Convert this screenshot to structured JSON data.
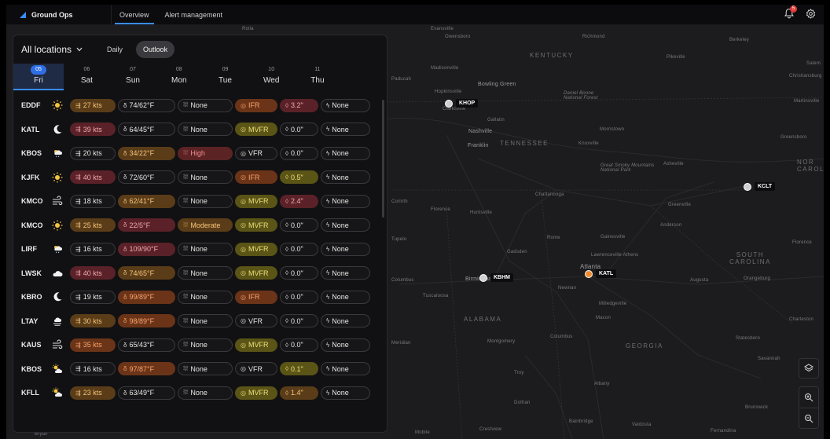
{
  "app": {
    "name": "Ground Ops"
  },
  "nav": {
    "tabs": [
      "Overview",
      "Alert management"
    ],
    "active": 0
  },
  "notifications": {
    "count": "5"
  },
  "panel": {
    "location_select": "All locations",
    "toggles": [
      "Daily",
      "Outlook"
    ],
    "active_toggle": "Outlook",
    "days": [
      {
        "num": "05",
        "name": "Fri"
      },
      {
        "num": "06",
        "name": "Sat"
      },
      {
        "num": "07",
        "name": "Sun"
      },
      {
        "num": "08",
        "name": "Mon"
      },
      {
        "num": "09",
        "name": "Tue"
      },
      {
        "num": "10",
        "name": "Wed"
      },
      {
        "num": "11",
        "name": "Thu"
      }
    ],
    "rows": [
      {
        "icao": "EDDF",
        "weather_icon": "sun-icon",
        "wind": "27 kts",
        "wind_level": "amber",
        "temp": "74/62°F",
        "temp_level": "",
        "precip": "None",
        "precip_level": "",
        "vis": "IFR",
        "vis_level": "orange",
        "rain": "3.2\"",
        "rain_level": "red",
        "storm": "None"
      },
      {
        "icao": "KATL",
        "weather_icon": "moon-icon",
        "wind": "39 kts",
        "wind_level": "red",
        "temp": "64/45°F",
        "temp_level": "",
        "precip": "None",
        "precip_level": "",
        "vis": "MVFR",
        "vis_level": "olive",
        "rain": "0.0\"",
        "rain_level": "",
        "storm": "None"
      },
      {
        "icao": "KBOS",
        "weather_icon": "rain-sun-icon",
        "wind": "20 kts",
        "wind_level": "",
        "temp": "34/22°F",
        "temp_level": "amber",
        "precip": "High",
        "precip_level": "redbg",
        "vis": "VFR",
        "vis_level": "",
        "rain": "0.0\"",
        "rain_level": "",
        "storm": "None"
      },
      {
        "icao": "KJFK",
        "weather_icon": "sun-icon",
        "wind": "40 kts",
        "wind_level": "red",
        "temp": "72/60°F",
        "temp_level": "",
        "precip": "None",
        "precip_level": "",
        "vis": "IFR",
        "vis_level": "orange",
        "rain": "0.5\"",
        "rain_level": "olive",
        "storm": "None"
      },
      {
        "icao": "KMCO",
        "weather_icon": "wind-icon",
        "wind": "18 kts",
        "wind_level": "",
        "temp": "62/41°F",
        "temp_level": "amber",
        "precip": "None",
        "precip_level": "",
        "vis": "MVFR",
        "vis_level": "olive",
        "rain": "2.4\"",
        "rain_level": "red",
        "storm": "None"
      },
      {
        "icao": "KMCO",
        "weather_icon": "sun-icon",
        "wind": "25 kts",
        "wind_level": "amber",
        "temp": "22/5°F",
        "temp_level": "red",
        "precip": "Moderate",
        "precip_level": "amber",
        "vis": "MVFR",
        "vis_level": "olive",
        "rain": "0.0\"",
        "rain_level": "",
        "storm": "None"
      },
      {
        "icao": "LIRF",
        "weather_icon": "rain-sun-icon",
        "wind": "16 kts",
        "wind_level": "",
        "temp": "109/90°F",
        "temp_level": "red",
        "precip": "None",
        "precip_level": "",
        "vis": "MVFR",
        "vis_level": "olive",
        "rain": "0.0\"",
        "rain_level": "",
        "storm": "None"
      },
      {
        "icao": "LWSK",
        "weather_icon": "cloud-icon",
        "wind": "40 kts",
        "wind_level": "red",
        "temp": "74/65°F",
        "temp_level": "amber",
        "precip": "None",
        "precip_level": "",
        "vis": "MVFR",
        "vis_level": "olive",
        "rain": "0.0\"",
        "rain_level": "",
        "storm": "None"
      },
      {
        "icao": "KBRO",
        "weather_icon": "moon-icon",
        "wind": "19 kts",
        "wind_level": "",
        "temp": "99/89°F",
        "temp_level": "orange",
        "precip": "None",
        "precip_level": "",
        "vis": "IFR",
        "vis_level": "orange",
        "rain": "0.0\"",
        "rain_level": "",
        "storm": "None"
      },
      {
        "icao": "LTAY",
        "weather_icon": "fog-icon",
        "wind": "30 kts",
        "wind_level": "amber",
        "temp": "98/89°F",
        "temp_level": "orange",
        "precip": "None",
        "precip_level": "",
        "vis": "VFR",
        "vis_level": "",
        "rain": "0.0\"",
        "rain_level": "",
        "storm": "None"
      },
      {
        "icao": "KAUS",
        "weather_icon": "wind-icon",
        "wind": "35 kts",
        "wind_level": "orange",
        "temp": "65/43°F",
        "temp_level": "",
        "precip": "None",
        "precip_level": "",
        "vis": "MVFR",
        "vis_level": "olive",
        "rain": "0.0\"",
        "rain_level": "",
        "storm": "None"
      },
      {
        "icao": "KBOS",
        "weather_icon": "sun-cloud-icon",
        "wind": "16 kts",
        "wind_level": "",
        "temp": "97/87°F",
        "temp_level": "orange",
        "precip": "None",
        "precip_level": "",
        "vis": "VFR",
        "vis_level": "",
        "rain": "0.1\"",
        "rain_level": "olive",
        "storm": "None"
      },
      {
        "icao": "KFLL",
        "weather_icon": "sun-cloud-icon",
        "wind": "23 kts",
        "wind_level": "amber",
        "temp": "63/49°F",
        "temp_level": "",
        "precip": "None",
        "precip_level": "",
        "vis": "MVFR",
        "vis_level": "olive",
        "rain": "1.4\"",
        "rain_level": "amber",
        "storm": "None"
      }
    ]
  },
  "map": {
    "airports": [
      {
        "code": "KHOP",
        "color": "gray"
      },
      {
        "code": "KCLT",
        "color": "gray"
      },
      {
        "code": "KBHM",
        "color": "gray"
      },
      {
        "code": "KATL",
        "color": "orange"
      }
    ],
    "labels": {
      "kentucky": "KENTUCKY",
      "tennessee": "TENNESSEE",
      "alabama": "ALABAMA",
      "georgia": "GEORGIA",
      "south_carolina": "SOUTH\nCAROLINA",
      "north_carolina": "NOR\nCAROL",
      "evansville": "Evansville",
      "owensboro": "Owensboro",
      "richmond": "Richmond",
      "berkeley": "Berkeley",
      "pikeville": "Pikeville",
      "madisonville": "Madisonville",
      "paducah": "Paducah",
      "bowling_green": "Bowling Green",
      "hopkinsville": "Hopkinsville",
      "clarksville": "Clarksville",
      "daniel_boone": "Daniel Boone\nNational Forest",
      "gallatin": "Gallatin",
      "nashville": "Nashville",
      "franklin": "Franklin",
      "morristown": "Morristown",
      "knoxville": "Knoxville",
      "greensboro": "Greensboro",
      "smoky": "Great Smoky Mountains\nNational Park",
      "asheville": "Asheville",
      "chattanooga": "Chattanooga",
      "corinth": "Corinth",
      "florence": "Florence",
      "huntsville": "Huntsville",
      "greenville": "Greenville",
      "anderson": "Anderson",
      "rome": "Rome",
      "gainesville": "Gainesville",
      "gadsden": "Gadsden",
      "lawrenceville": "Lawrenceville Athens",
      "atlanta": "Atlanta",
      "birmingham": "Birmingham",
      "columbus_ms": "Columbus",
      "tuscaloosa": "Tuscaloosa",
      "newnan": "Newnan",
      "augusta": "Augusta",
      "orangeburg": "Orangeburg",
      "milledgeville": "Milledgeville",
      "macon": "Macon",
      "charleston": "Charleston",
      "montgomery": "Montgomery",
      "columbus_ga": "Columbus",
      "statesboro": "Statesboro",
      "savannah": "Savannah",
      "albany": "Albany",
      "dothan": "Dothan",
      "brunswick": "Brunswick",
      "valdosta": "Valdosta",
      "bainbridge": "Bainbridge",
      "fernandina": "Fernandina",
      "mobile": "Mobile",
      "crestview": "Crestview",
      "salem": "Salem",
      "martinsville": "Martinsville",
      "florence_sc": "Florence",
      "meridian": "Meridian",
      "tupelo": "Tupelo",
      "bryan": "Bryan",
      "rolla": "Rolla",
      "christiansburg": "Christiansburg",
      "troy": "Troy"
    }
  }
}
